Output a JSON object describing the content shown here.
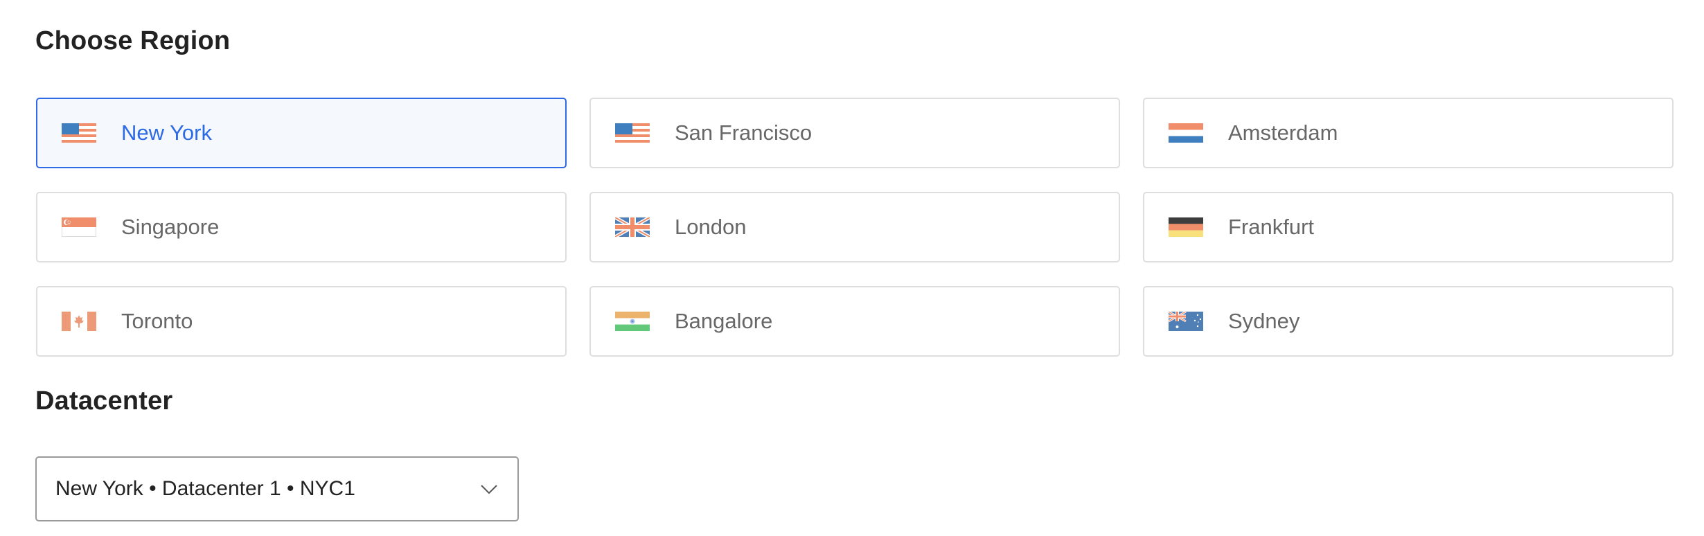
{
  "region_section": {
    "title": "Choose Region",
    "selected": "New York",
    "regions": [
      {
        "label": "New York",
        "flag": "us-flag-icon",
        "selected": true
      },
      {
        "label": "San Francisco",
        "flag": "us-flag-icon",
        "selected": false
      },
      {
        "label": "Amsterdam",
        "flag": "netherlands-flag-icon",
        "selected": false
      },
      {
        "label": "Singapore",
        "flag": "singapore-flag-icon",
        "selected": false
      },
      {
        "label": "London",
        "flag": "uk-flag-icon",
        "selected": false
      },
      {
        "label": "Frankfurt",
        "flag": "germany-flag-icon",
        "selected": false
      },
      {
        "label": "Toronto",
        "flag": "canada-flag-icon",
        "selected": false
      },
      {
        "label": "Bangalore",
        "flag": "india-flag-icon",
        "selected": false
      },
      {
        "label": "Sydney",
        "flag": "australia-flag-icon",
        "selected": false
      }
    ]
  },
  "datacenter_section": {
    "title": "Datacenter",
    "select": {
      "value": "New York • Datacenter 1 • NYC1",
      "icon": "chevron-down-icon"
    }
  },
  "colors": {
    "accent": "#2d6ae6",
    "selected_bg": "#f5f8fd",
    "card_border": "#dedede",
    "label_text": "#676767",
    "heading_text": "#222222",
    "flag_orange": "#f08e6c",
    "flag_blue": "#3f7fbf"
  }
}
